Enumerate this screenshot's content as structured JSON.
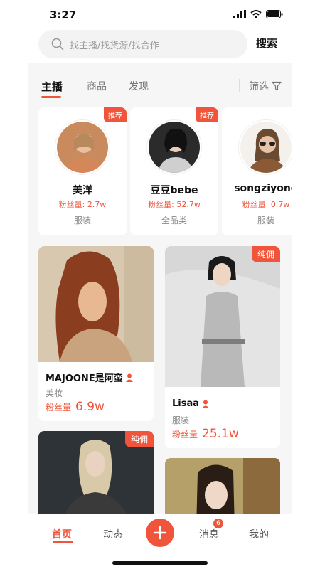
{
  "status": {
    "time": "3:27"
  },
  "search": {
    "placeholder": "找主播/找货源/找合作",
    "button_label": "搜索"
  },
  "tabs": [
    {
      "label": "主播",
      "active": true
    },
    {
      "label": "商品",
      "active": false
    },
    {
      "label": "发现",
      "active": false
    }
  ],
  "filter_label": "筛选",
  "streamers": [
    {
      "name": "美洋",
      "fans_label": "粉丝量",
      "fans": "2.7w",
      "category": "服装",
      "badge": "推荐"
    },
    {
      "name": "豆豆bebe",
      "fans_label": "粉丝量",
      "fans": "52.7w",
      "category": "全品类",
      "badge": "推荐"
    },
    {
      "name": "songziyong",
      "fans_label": "粉丝量",
      "fans": "0.7w",
      "category": "服装",
      "badge": ""
    }
  ],
  "feed": [
    {
      "name": "MAJOONE是阿蛮",
      "category": "美妆",
      "fans_label": "粉丝量",
      "fans": "6.9w",
      "badge": ""
    },
    {
      "name": "Lisaa",
      "category": "服装",
      "fans_label": "粉丝量",
      "fans": "25.1w",
      "badge": "纯佣"
    },
    {
      "name": "",
      "category": "",
      "fans_label": "",
      "fans": "",
      "badge": "纯佣"
    },
    {
      "name": "",
      "category": "",
      "fans_label": "",
      "fans": "",
      "badge": ""
    }
  ],
  "nav": {
    "home": "首页",
    "feed": "动态",
    "messages": "消息",
    "messages_count": "6",
    "me": "我的"
  },
  "colors": {
    "accent": "#f0543a",
    "background": "#f6f6f6"
  }
}
